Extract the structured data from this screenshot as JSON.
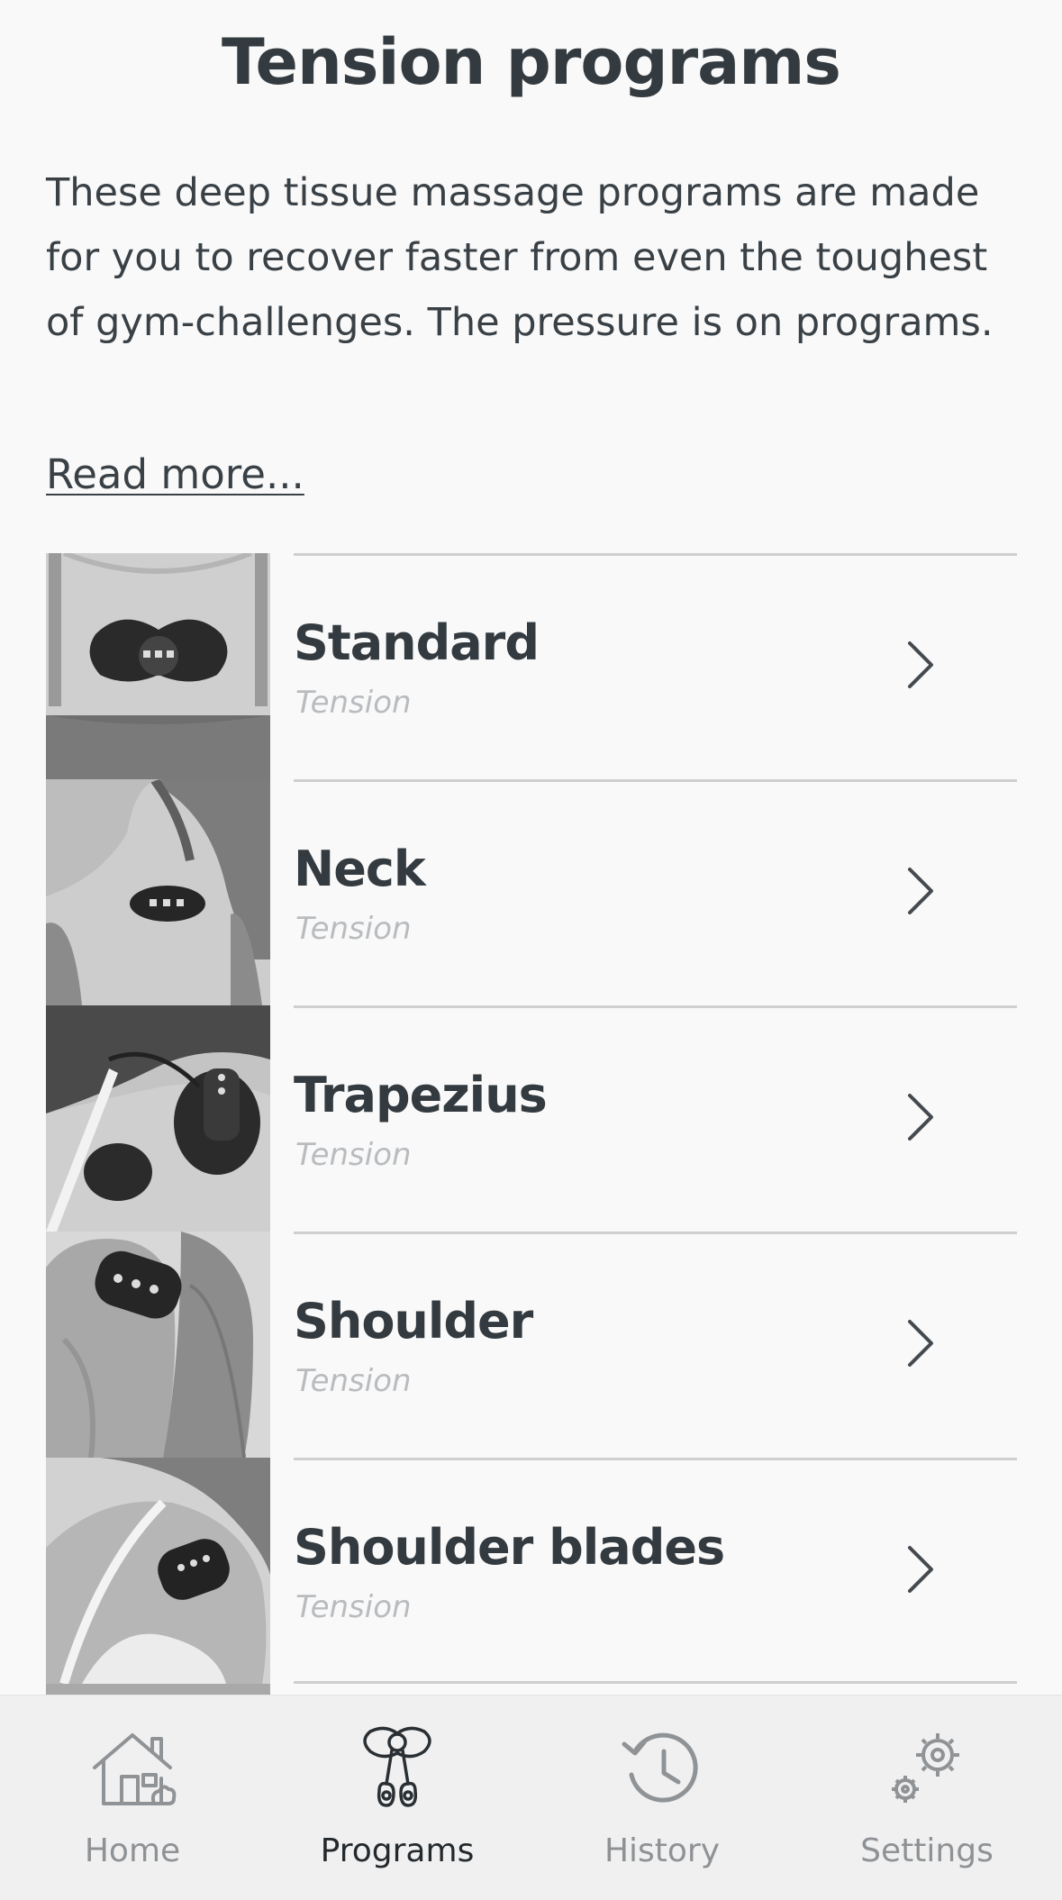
{
  "page": {
    "title": "Tension programs",
    "intro": "These deep tissue massage programs are made for you to recover faster from even the toughest of gym-challenges. The pressure is on programs.",
    "read_more": "Read more..."
  },
  "programs": [
    {
      "title": "Standard",
      "subtitle": "Tension",
      "image": "upper-back-device-photo"
    },
    {
      "title": "Neck",
      "subtitle": "Tension",
      "image": "neck-device-photo"
    },
    {
      "title": "Trapezius",
      "subtitle": "Tension",
      "image": "trapezius-device-photo"
    },
    {
      "title": "Shoulder",
      "subtitle": "Tension",
      "image": "shoulder-device-photo"
    },
    {
      "title": "Shoulder blades",
      "subtitle": "Tension",
      "image": "shoulder-blades-device-photo"
    }
  ],
  "tabbar": {
    "tabs": [
      {
        "label": "Home",
        "icon": "house-icon",
        "active": false
      },
      {
        "label": "Programs",
        "icon": "device-pads-icon",
        "active": true
      },
      {
        "label": "History",
        "icon": "history-clock-icon",
        "active": false
      },
      {
        "label": "Settings",
        "icon": "gear-icon",
        "active": false
      }
    ]
  },
  "colors": {
    "background": "#f9f9f9",
    "text": "#343b40",
    "subtitle": "#b9bcbf",
    "divider": "#cfcfcf",
    "tabbar": "#f0f0f0",
    "tab_inactive": "#8f9295",
    "tab_active": "#24292d"
  }
}
